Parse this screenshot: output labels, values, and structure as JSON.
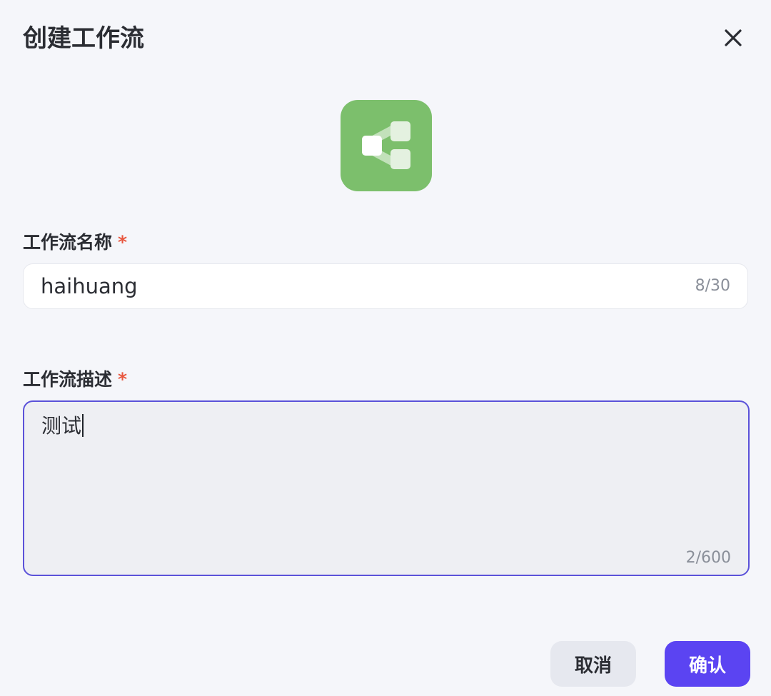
{
  "dialog": {
    "title": "创建工作流",
    "close_icon": "close-icon"
  },
  "app_icon": {
    "icon": "workflow-tree-icon",
    "background": "#7cbf6c"
  },
  "name_field": {
    "label": "工作流名称",
    "required_mark": "*",
    "value": "haihuang",
    "counter": "8/30"
  },
  "desc_field": {
    "label": "工作流描述",
    "required_mark": "*",
    "value": "测试",
    "counter": "2/600"
  },
  "footer": {
    "cancel_label": "取消",
    "confirm_label": "确认"
  },
  "colors": {
    "accent": "#5b44f2",
    "focus_border": "#5b52d9",
    "required": "#e8573f"
  }
}
